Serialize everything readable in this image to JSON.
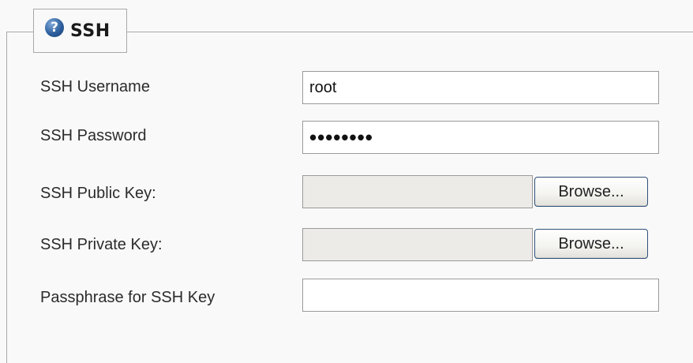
{
  "section": {
    "title": "SSH",
    "help_icon": "question-circle-icon"
  },
  "fields": {
    "username": {
      "label": "SSH Username",
      "value": "root"
    },
    "password": {
      "label": "SSH Password",
      "value": "••••••••"
    },
    "public_key": {
      "label": "SSH Public Key:",
      "button_label": "Browse..."
    },
    "private_key": {
      "label": "SSH Private Key:",
      "button_label": "Browse..."
    },
    "passphrase": {
      "label": "Passphrase for SSH Key",
      "value": ""
    }
  }
}
